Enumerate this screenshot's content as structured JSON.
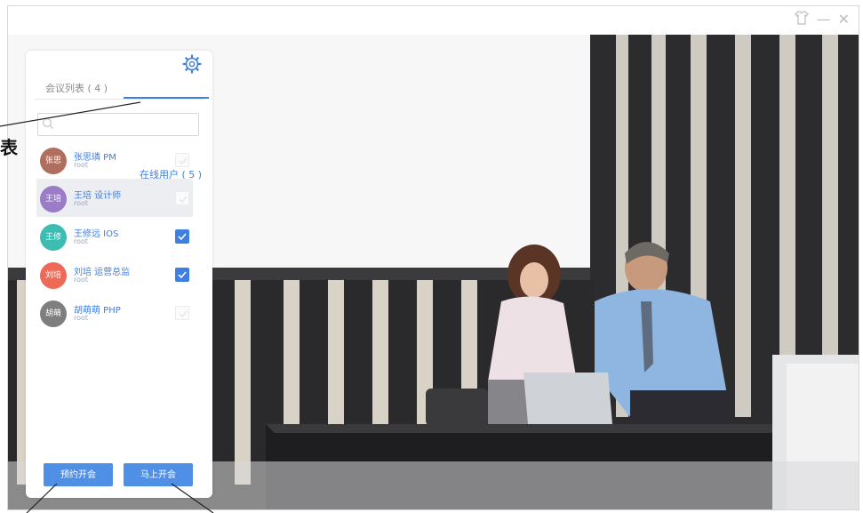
{
  "window": {
    "icons": [
      "shirt-icon",
      "minimize-icon",
      "close-icon"
    ],
    "minimize_glyph": "—",
    "close_glyph": "✕"
  },
  "panel": {
    "tabs": [
      {
        "label": "会议列表 ( 4 )",
        "active": false
      },
      {
        "label": "在线用户 ( 5 )",
        "active": true
      }
    ],
    "search": {
      "placeholder": ""
    },
    "users": [
      {
        "avatar": "张思",
        "name": "张思璘 PM",
        "role": "root",
        "checked": false,
        "selected": false,
        "color": "#b06e5f"
      },
      {
        "avatar": "王培",
        "name": "王培 设计师",
        "role": "root",
        "checked": false,
        "selected": true,
        "color": "#9a7cc7"
      },
      {
        "avatar": "王修",
        "name": "王修远 IOS",
        "role": "root",
        "checked": true,
        "selected": false,
        "color": "#3dbdb2"
      },
      {
        "avatar": "刘培",
        "name": "刘培 运营总监",
        "role": "root",
        "checked": true,
        "selected": false,
        "color": "#ef6a56"
      },
      {
        "avatar": "胡萌",
        "name": "胡萌萌 PHP",
        "role": "root",
        "checked": false,
        "selected": false,
        "color": "#7e7e7e"
      }
    ],
    "buttons": {
      "reserve": "预约开会",
      "start": "马上开会"
    },
    "accent": "#3f7fe0"
  },
  "annotation": {
    "label": "表"
  }
}
